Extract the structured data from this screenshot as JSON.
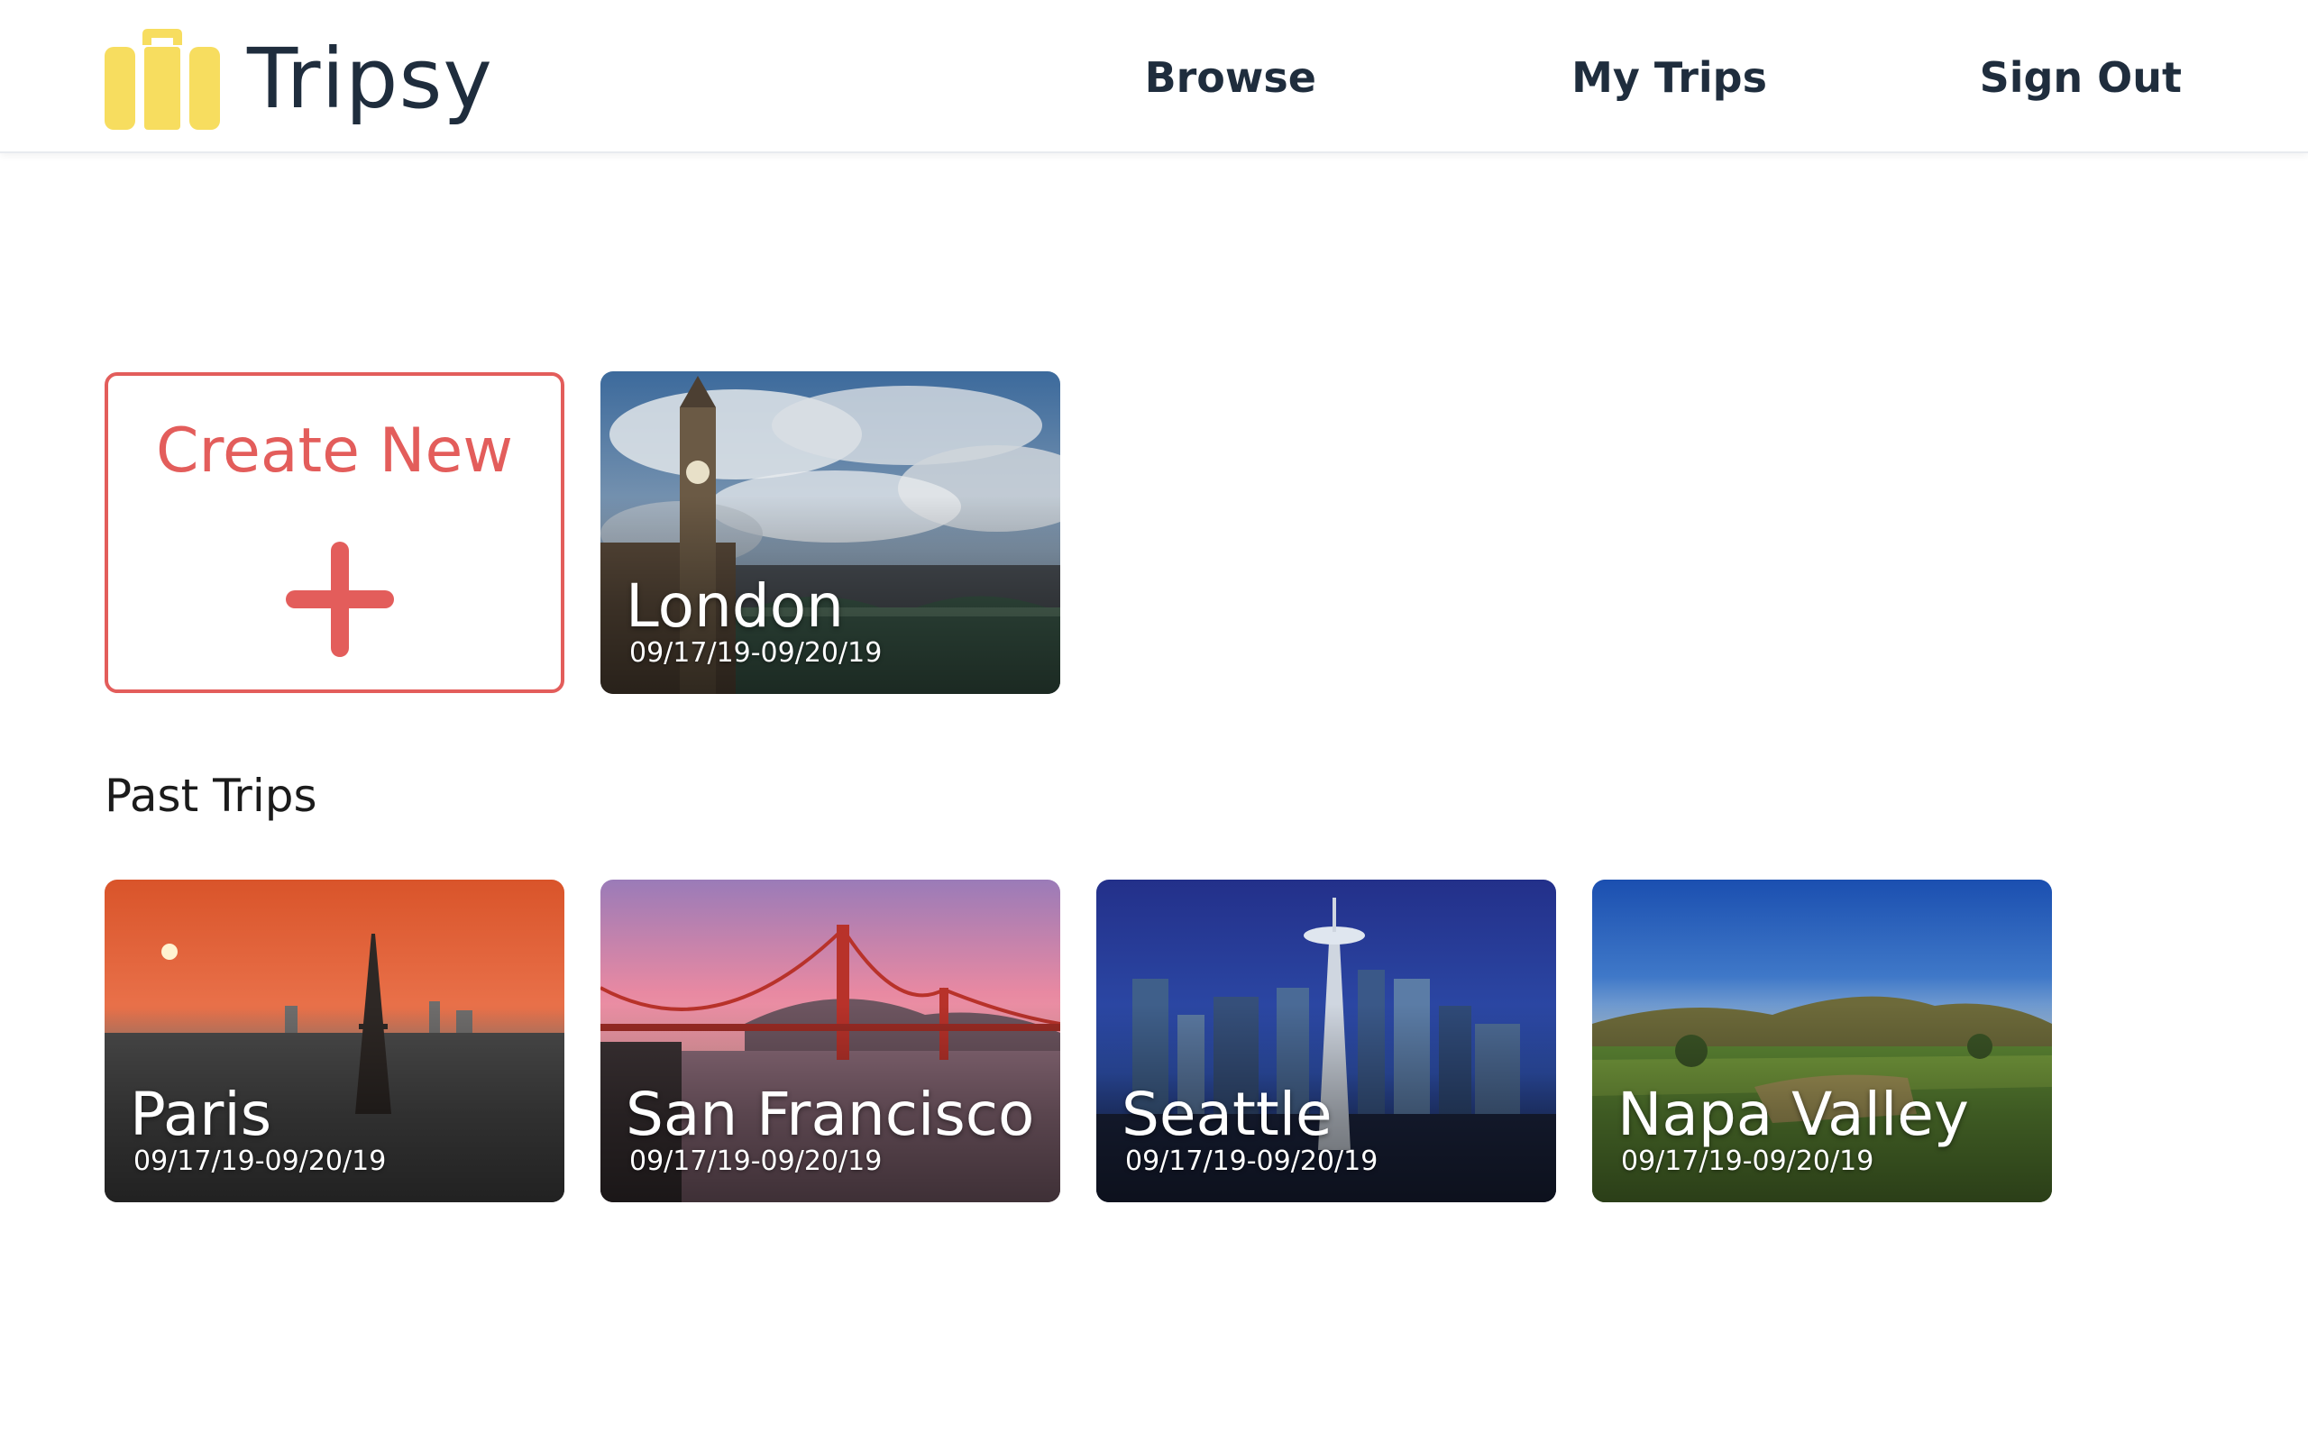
{
  "app": {
    "name": "Tripsy",
    "logo_color": "#f7dd5f",
    "accent_color": "#e35d5b",
    "text_color": "#1f2d3d"
  },
  "nav": {
    "items": [
      {
        "label": "Browse"
      },
      {
        "label": "My Trips"
      },
      {
        "label": "Sign Out"
      }
    ]
  },
  "upcoming": {
    "create_label": "Create New",
    "create_icon": "plus-icon",
    "trips": [
      {
        "name": "London",
        "dates": "09/17/19-09/20/19",
        "image": "london-big-ben-bridge"
      }
    ]
  },
  "past": {
    "title": "Past Trips",
    "trips": [
      {
        "name": "Paris",
        "dates": "09/17/19-09/20/19",
        "image": "paris-eiffel-sunset"
      },
      {
        "name": "San Francisco",
        "dates": "09/17/19-09/20/19",
        "image": "golden-gate-bridge"
      },
      {
        "name": "Seattle",
        "dates": "09/17/19-09/20/19",
        "image": "seattle-space-needle-night"
      },
      {
        "name": "Napa Valley",
        "dates": "09/17/19-09/20/19",
        "image": "napa-vineyards"
      }
    ]
  }
}
